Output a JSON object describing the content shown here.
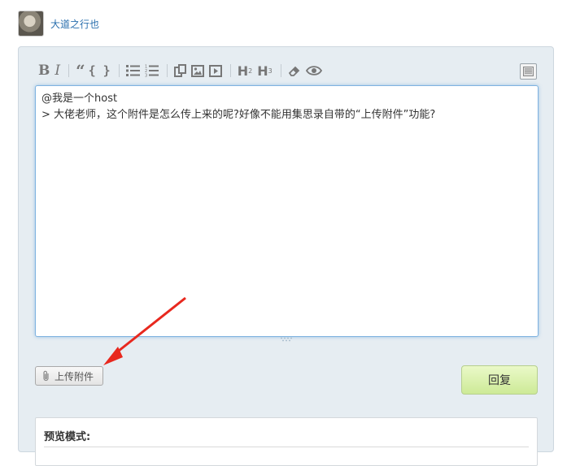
{
  "user": {
    "name": "大道之行也"
  },
  "toolbar": {
    "buttons": [
      {
        "name": "bold-button",
        "glyph": "B"
      },
      {
        "name": "italic-button",
        "glyph": "I"
      },
      {
        "name": "quote-button",
        "glyph": "“"
      },
      {
        "name": "code-button",
        "glyph": "{ }"
      },
      {
        "name": "unordered-list-button",
        "icon": "bullet-list-icon"
      },
      {
        "name": "ordered-list-button",
        "icon": "numbered-list-icon"
      },
      {
        "name": "link-button",
        "icon": "link-icon"
      },
      {
        "name": "image-button",
        "icon": "image-icon"
      },
      {
        "name": "video-button",
        "icon": "video-icon"
      },
      {
        "name": "heading2-button",
        "glyph": "H",
        "sub": "2"
      },
      {
        "name": "heading3-button",
        "glyph": "H",
        "sub": "3"
      },
      {
        "name": "eraser-button",
        "icon": "eraser-icon"
      },
      {
        "name": "preview-button",
        "icon": "eye-icon"
      }
    ],
    "fullscreen_icon": "document-icon"
  },
  "editor": {
    "lines": [
      "@我是一个host",
      "> 大佬老师，这个附件是怎么传上来的呢?好像不能用集思录自带的“上传附件”功能?"
    ]
  },
  "actions": {
    "upload_label": "上传附件",
    "upload_icon": "paperclip-icon",
    "reply_label": "回复"
  },
  "preview": {
    "label": "预览模式:"
  },
  "annotation": {
    "color": "#e8281e"
  },
  "colors": {
    "link": "#2a6fae",
    "panel_bg": "#e6edf2",
    "editor_focus_border": "#7fb3e0",
    "reply_bg": "#cdea97"
  }
}
